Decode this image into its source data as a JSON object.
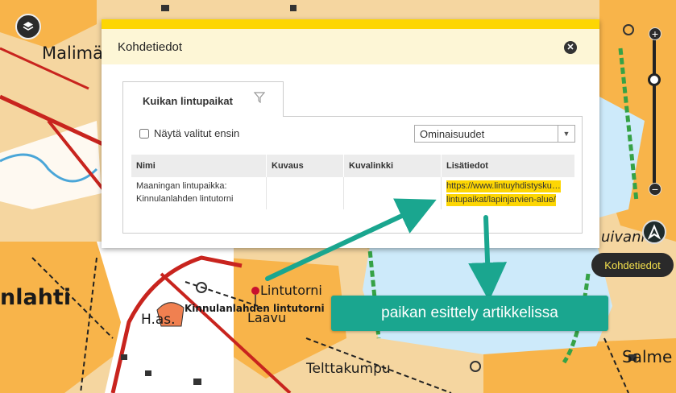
{
  "map": {
    "labels": {
      "malima": "Malimä",
      "lahti": "nlahti",
      "lintutorni": "Lintutorni",
      "kinnulanlahden": "Kinnulanlahden lintutorni",
      "laavu": "Laavu",
      "has": "H.as.",
      "telttakumpu": "Telttakumpu",
      "salme": "Salme",
      "uivanne": "uivanne"
    },
    "colors": {
      "land": "#f5d6a0",
      "field": "#f8b44a",
      "water": "#cdeafa",
      "road": "#c8241e",
      "wetland": "#36a246"
    }
  },
  "controls": {
    "layers_icon": "layers-icon",
    "zoom_in": "+",
    "zoom_out": "−",
    "kohdetiedot_button": "Kohdetiedot"
  },
  "panel": {
    "title": "Kohdetiedot",
    "close_icon": "close-icon",
    "tab": {
      "label": "Kuikan lintupaikat",
      "filter_icon": "filter-icon"
    },
    "checkbox_label": "Näytä valitut ensin",
    "select_value": "Ominaisuudet",
    "table": {
      "columns": [
        "Nimi",
        "Kuvaus",
        "Kuvalinkki",
        "Lisätiedot"
      ],
      "rows": [
        {
          "nimi_line1": "Maaningan lintupaikka:",
          "nimi_line2": "Kinnulanlahden lintutorni",
          "kuvaus": "",
          "kuvalinkki": "",
          "lisatiedot_line1": "https://www.lintuyhdistysku…",
          "lisatiedot_line2": "lintupaikat/lapinjarvien-alue/"
        }
      ]
    }
  },
  "annotation": {
    "callout_text": "paikan esittely artikkelissa",
    "color": "#1aa68f"
  }
}
